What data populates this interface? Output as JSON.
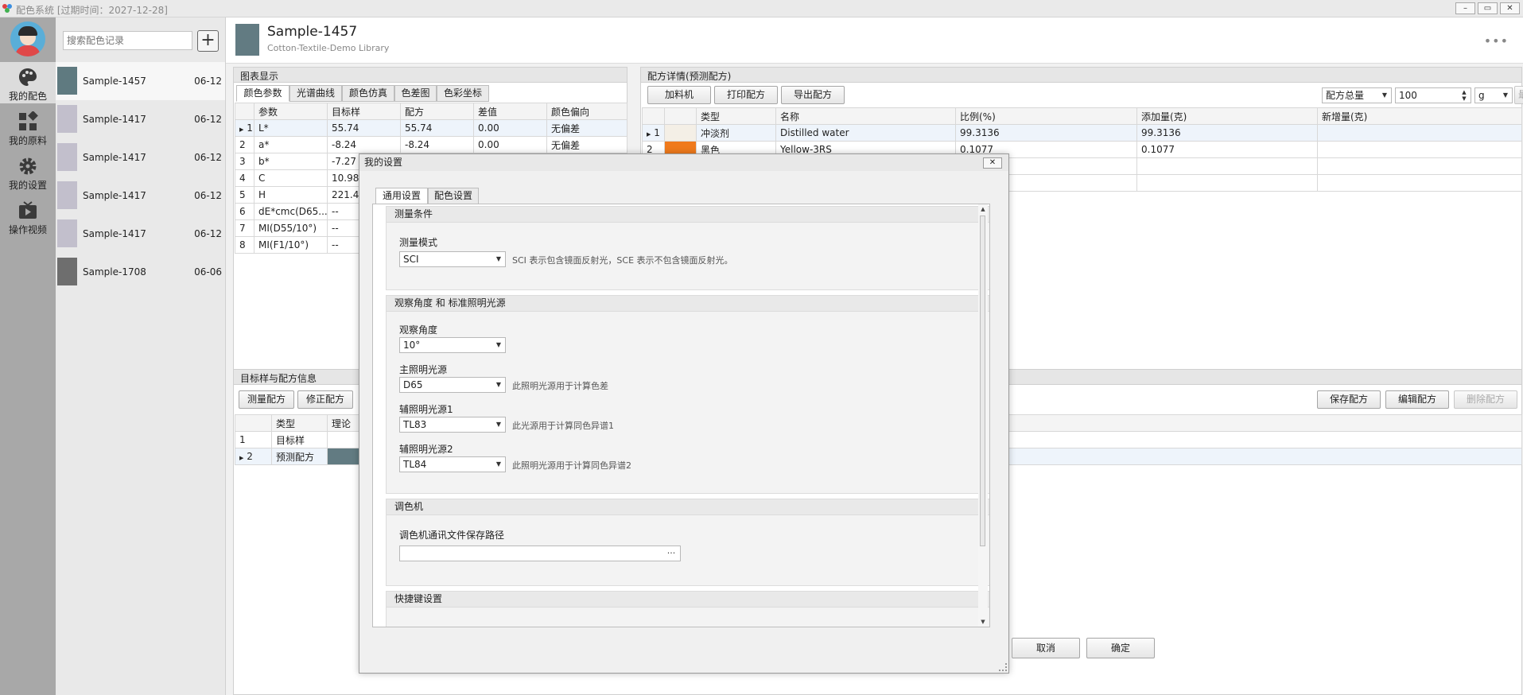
{
  "window": {
    "title": "配色系统 [过期时间：2027-12-28]",
    "minimize": "–",
    "maximize": "▭",
    "close": "✕"
  },
  "nav": {
    "items": [
      {
        "label": "我的配色",
        "icon": "palette-icon"
      },
      {
        "label": "我的原料",
        "icon": "materials-icon"
      },
      {
        "label": "我的设置",
        "icon": "gear-icon"
      },
      {
        "label": "操作视频",
        "icon": "video-icon"
      }
    ]
  },
  "records": {
    "search_placeholder": "搜索配色记录",
    "add_label": "+",
    "items": [
      {
        "name": "Sample-1457",
        "date": "06-12",
        "color": "#5f7a80"
      },
      {
        "name": "Sample-1417",
        "date": "06-12",
        "color": "#c2bfcc"
      },
      {
        "name": "Sample-1417",
        "date": "06-12",
        "color": "#c2bfcc"
      },
      {
        "name": "Sample-1417",
        "date": "06-12",
        "color": "#c2bfcc"
      },
      {
        "name": "Sample-1417",
        "date": "06-12",
        "color": "#c2bfcc"
      },
      {
        "name": "Sample-1708",
        "date": "06-06",
        "color": "#6e6e6e"
      }
    ]
  },
  "header": {
    "title": "Sample-1457",
    "subtitle": "Cotton-Textile-Demo Library",
    "more": "•••",
    "swatch": "#627b82"
  },
  "chart_panel": {
    "title": "图表显示",
    "tabs": [
      "颜色参数",
      "光谱曲线",
      "颜色仿真",
      "色差图",
      "色彩坐标"
    ],
    "columns": [
      "",
      "参数",
      "目标样",
      "配方",
      "差值",
      "颜色偏向"
    ],
    "rows": [
      [
        "1",
        "L*",
        "55.74",
        "55.74",
        "0.00",
        "无偏差"
      ],
      [
        "2",
        "a*",
        "-8.24",
        "-8.24",
        "0.00",
        "无偏差"
      ],
      [
        "3",
        "b*",
        "-7.27",
        "",
        "",
        ""
      ],
      [
        "4",
        "C",
        "10.98",
        "",
        "",
        ""
      ],
      [
        "5",
        "H",
        "221.4",
        "",
        "",
        ""
      ],
      [
        "6",
        "dE*cmc(D65...",
        "--",
        "",
        "",
        ""
      ],
      [
        "7",
        "MI(D55/10°)",
        "--",
        "",
        "",
        ""
      ],
      [
        "8",
        "MI(F1/10°)",
        "--",
        "",
        "",
        ""
      ]
    ]
  },
  "formula_panel": {
    "title": "配方详情(预测配方)",
    "buttons": [
      "加料机",
      "打印配方",
      "导出配方"
    ],
    "total_combo": "配方总量",
    "total_value": "100",
    "unit": "g",
    "min_add_btn": "最小新增量",
    "columns": [
      "",
      "",
      "类型",
      "名称",
      "比例(%)",
      "添加量(克)",
      "新增量(克)"
    ],
    "rows": [
      {
        "idx": "1",
        "color": "#f4efe6",
        "type": "冲淡剂",
        "name": "Distilled water",
        "ratio": "99.3136",
        "amount": "99.3136",
        "add": ""
      },
      {
        "idx": "2",
        "color": "#f07a1c",
        "type": "黑色",
        "name": "Yellow-3RS",
        "ratio": "0.1077",
        "amount": "0.1077",
        "add": ""
      }
    ]
  },
  "target_panel": {
    "title": "目标样与配方信息",
    "buttons": [
      "测量配方",
      "修正配方"
    ],
    "right_buttons": [
      "保存配方",
      "编辑配方",
      "删除配方"
    ],
    "columns": [
      "",
      "类型",
      "理论"
    ],
    "rows": [
      {
        "idx": "1",
        "type": "目标样"
      },
      {
        "idx": "2",
        "type": "预测配方",
        "swatch": "#627b82"
      }
    ]
  },
  "dialog": {
    "title": "我的设置",
    "close": "✕",
    "tabs": [
      "通用设置",
      "配色设置"
    ],
    "sections": {
      "measure": {
        "title": "测量条件",
        "mode_label": "测量模式",
        "mode_value": "SCI",
        "mode_hint": "SCI 表示包含镜面反射光，SCE 表示不包含镜面反射光。"
      },
      "observer": {
        "title": "观察角度 和 标准照明光源",
        "angle_label": "观察角度",
        "angle_value": "10°",
        "main_label": "主照明光源",
        "main_value": "D65",
        "main_hint": "此照明光源用于计算色差",
        "aux1_label": "辅照明光源1",
        "aux1_value": "TL83",
        "aux1_hint": "此光源用于计算同色异谱1",
        "aux2_label": "辅照明光源2",
        "aux2_value": "TL84",
        "aux2_hint": "此照明光源用于计算同色异谱2"
      },
      "dispenser": {
        "title": "调色机",
        "path_label": "调色机通讯文件保存路径",
        "path_value": "",
        "browse": "···"
      },
      "shortcut": {
        "title": "快捷键设置"
      }
    },
    "cancel": "取消",
    "ok": "确定"
  }
}
